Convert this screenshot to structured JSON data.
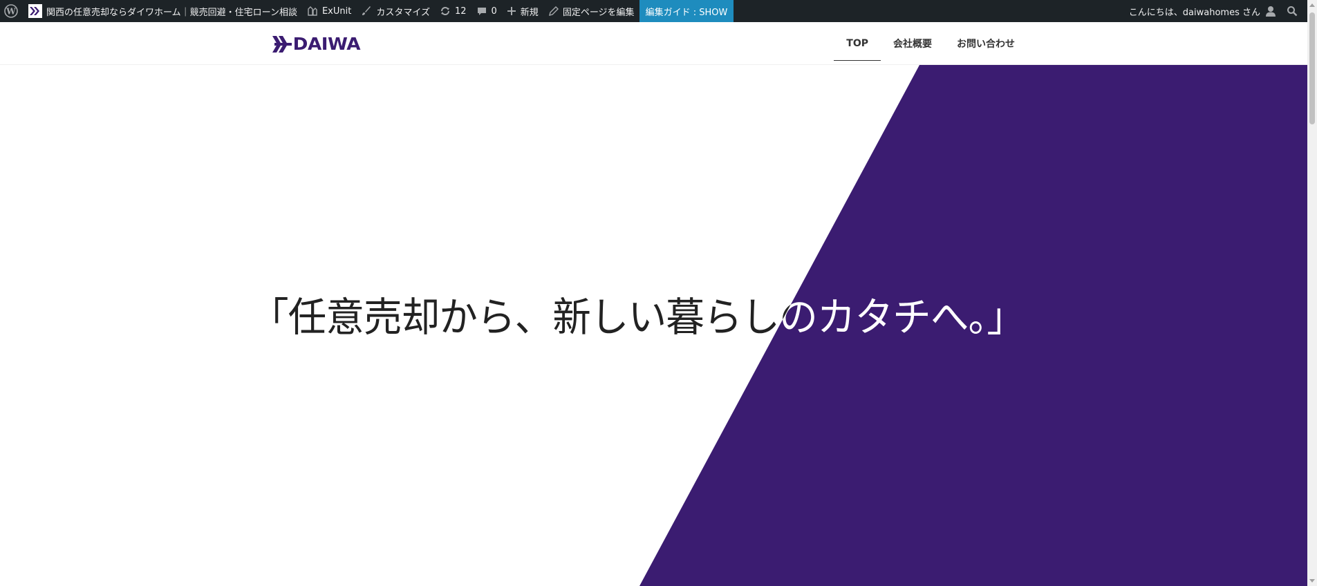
{
  "admin_bar": {
    "site_name": "関西の任意売却ならダイワホーム｜競売回避・住宅ローン相談",
    "exunit_label": "ExUnit",
    "customize_label": "カスタマイズ",
    "updates_count": "12",
    "comments_count": "0",
    "new_label": "新規",
    "edit_page_label": "固定ページを編集",
    "guide_label": "編集ガイド : SHOW",
    "greeting": "こんにちは、daiwahomes さん",
    "icons": [
      "wordpress-logo-icon",
      "site-icon",
      "exunit-icon",
      "brush-icon",
      "updates-icon",
      "comment-icon",
      "plus-icon",
      "pencil-icon",
      "user-icon",
      "search-icon"
    ]
  },
  "header": {
    "logo_text": "DAIWA",
    "nav": [
      {
        "label": "TOP",
        "active": true
      },
      {
        "label": "会社概要",
        "active": false
      },
      {
        "label": "お問い合わせ",
        "active": false
      }
    ]
  },
  "hero": {
    "catchphrase": "「任意売却から、新しい暮らしのカタチへ。」"
  },
  "colors": {
    "admin_bar_bg": "#1d2327",
    "guide_bg": "#1e8cbe",
    "brand_purple": "#3b1c71",
    "hero_text_dark": "#222222",
    "hero_text_light": "#ffffff"
  }
}
